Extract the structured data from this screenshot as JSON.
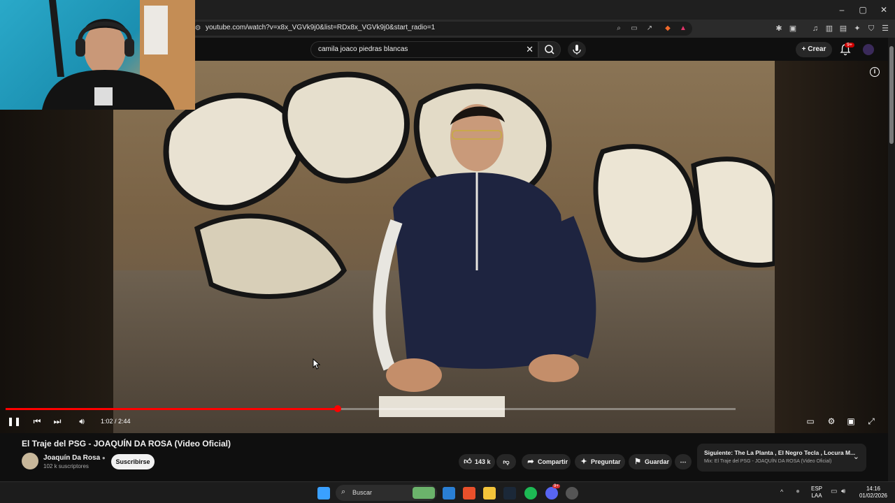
{
  "browser": {
    "url": "youtube.com/watch?v=x8x_VGVk9j0&list=RDx8x_VGVk9j0&start_radio=1",
    "window_controls": [
      "–",
      "▢",
      "✕"
    ]
  },
  "header": {
    "search_value": "camila joaco piedras blancas",
    "create_label": "Crear",
    "notif_badge": "9+"
  },
  "player": {
    "time_display": "1:02 / 2:44",
    "progress": 0.455
  },
  "video": {
    "title": "El Traje del PSG - JOAQUÍN DA ROSA (Video Oficial)",
    "channel_name": "Joaquín Da Rosa",
    "subscribers": "102 k suscriptores",
    "subscribe_label": "Suscribirse",
    "likes": "143 k",
    "share_label": "Compartir",
    "ask_label": "Preguntar",
    "save_label": "Guardar"
  },
  "up_next": {
    "title": "Siguiente: The La Planta , El Negro Tecla , Locura M...",
    "subtitle": "Mix: El Traje del PSG - JOAQUÍN DA ROSA (Video Oficial)"
  },
  "taskbar": {
    "search_placeholder": "Buscar",
    "lang_1": "ESP",
    "lang_2": "LAA",
    "time": "14:16",
    "date": "01/02/2026",
    "discord_badge": "9+"
  },
  "colors": {
    "yt_red": "#ff0000",
    "background": "#0f0f0f",
    "pill": "#272727"
  }
}
